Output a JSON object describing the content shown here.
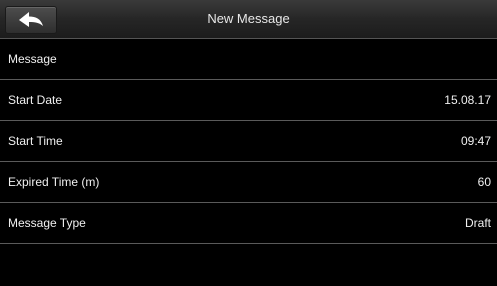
{
  "header": {
    "title": "New Message",
    "back_icon": "back-arrow-icon"
  },
  "rows": [
    {
      "label": "Message",
      "value": ""
    },
    {
      "label": "Start Date",
      "value": "15.08.17"
    },
    {
      "label": "Start Time",
      "value": "09:47"
    },
    {
      "label": "Expired Time (m)",
      "value": "60"
    },
    {
      "label": "Message Type",
      "value": "Draft"
    }
  ],
  "colors": {
    "background": "#000000",
    "divider": "#5a5a5a",
    "text": "#f0f0f0"
  }
}
